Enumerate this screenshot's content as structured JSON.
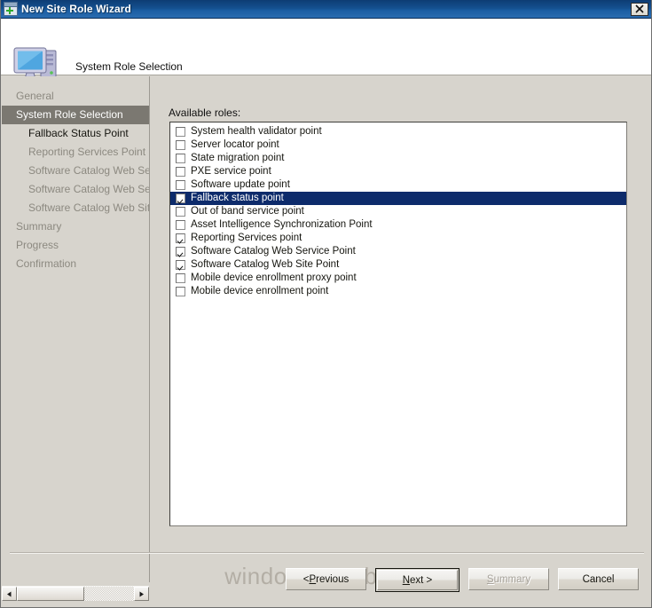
{
  "window": {
    "title": "New Site Role Wizard",
    "icon": "new-window-icon",
    "close_label": "Close"
  },
  "header": {
    "title": "System Role Selection",
    "icon": "computer-icon"
  },
  "sidebar": {
    "items": [
      {
        "label": "General",
        "level": 0,
        "state": "pending"
      },
      {
        "label": "System Role Selection",
        "level": 0,
        "state": "current"
      },
      {
        "label": "Fallback Status Point",
        "level": 1,
        "state": "active"
      },
      {
        "label": "Reporting Services Point",
        "level": 1,
        "state": "pending"
      },
      {
        "label": "Software Catalog Web Ser",
        "level": 1,
        "state": "pending"
      },
      {
        "label": "Software Catalog Web Ser",
        "level": 1,
        "state": "pending"
      },
      {
        "label": "Software Catalog Web Site",
        "level": 1,
        "state": "pending"
      },
      {
        "label": "Summary",
        "level": 0,
        "state": "pending"
      },
      {
        "label": "Progress",
        "level": 0,
        "state": "pending"
      },
      {
        "label": "Confirmation",
        "level": 0,
        "state": "pending"
      }
    ],
    "scrollbar": {
      "left_arrow": "◀",
      "right_arrow": "▶"
    }
  },
  "main": {
    "roles_label": "Available roles:",
    "roles": [
      {
        "label": "System health validator point",
        "checked": false,
        "selected": false
      },
      {
        "label": "Server locator point",
        "checked": false,
        "selected": false
      },
      {
        "label": "State migration point",
        "checked": false,
        "selected": false
      },
      {
        "label": "PXE service point",
        "checked": false,
        "selected": false
      },
      {
        "label": "Software update point",
        "checked": false,
        "selected": false
      },
      {
        "label": "Fallback status point",
        "checked": true,
        "selected": true
      },
      {
        "label": "Out of band service point",
        "checked": false,
        "selected": false
      },
      {
        "label": "Asset Intelligence Synchronization Point",
        "checked": false,
        "selected": false
      },
      {
        "label": "Reporting Services point",
        "checked": true,
        "selected": false
      },
      {
        "label": "Software Catalog Web Service Point",
        "checked": true,
        "selected": false
      },
      {
        "label": "Software Catalog Web Site Point",
        "checked": true,
        "selected": false
      },
      {
        "label": "Mobile device enrollment proxy point",
        "checked": false,
        "selected": false
      },
      {
        "label": "Mobile device enrollment point",
        "checked": false,
        "selected": false
      }
    ]
  },
  "watermark": {
    "text": "windows-noob.com"
  },
  "footer": {
    "previous": {
      "pre": "< ",
      "acc": "P",
      "post": "revious",
      "disabled": false
    },
    "next": {
      "pre": "",
      "acc": "N",
      "post": "ext >",
      "disabled": false,
      "default": true
    },
    "summary": {
      "pre": "",
      "acc": "S",
      "post": "ummary",
      "disabled": true
    },
    "cancel": {
      "pre": "",
      "acc": "",
      "post": "Cancel",
      "disabled": false
    }
  },
  "colors": {
    "titlebar": "#14508f",
    "selection": "#0d2b6b",
    "face": "#d7d4cd",
    "current_step": "#7b7871"
  }
}
